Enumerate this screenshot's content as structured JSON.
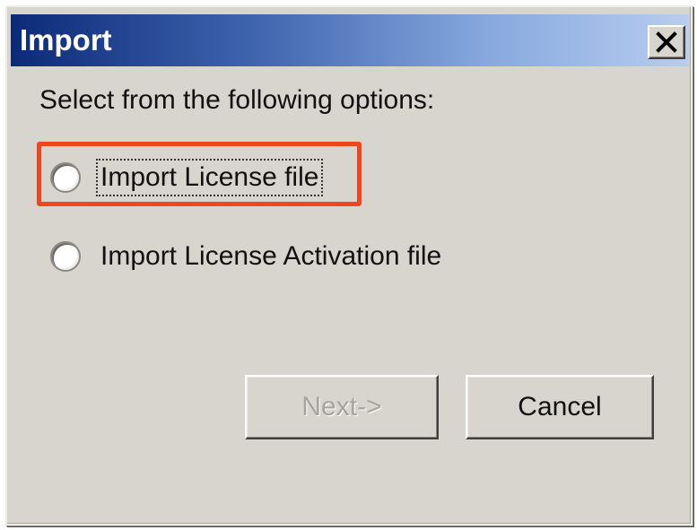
{
  "dialog": {
    "title": "Import",
    "prompt": "Select from the following options:",
    "options": [
      {
        "label": "Import License file",
        "selected": false,
        "focused": true,
        "highlighted": true
      },
      {
        "label": "Import License Activation file",
        "selected": false,
        "focused": false,
        "highlighted": false
      }
    ],
    "buttons": {
      "next_label": "Next->",
      "next_enabled": false,
      "cancel_label": "Cancel"
    },
    "close_icon": "close-icon",
    "colors": {
      "title_gradient_start": "#0c2a77",
      "title_gradient_end": "#b8cdef",
      "face": "#d8d5ce",
      "highlight_box": "#f0451e",
      "disabled_text": "#a6a39c"
    }
  }
}
